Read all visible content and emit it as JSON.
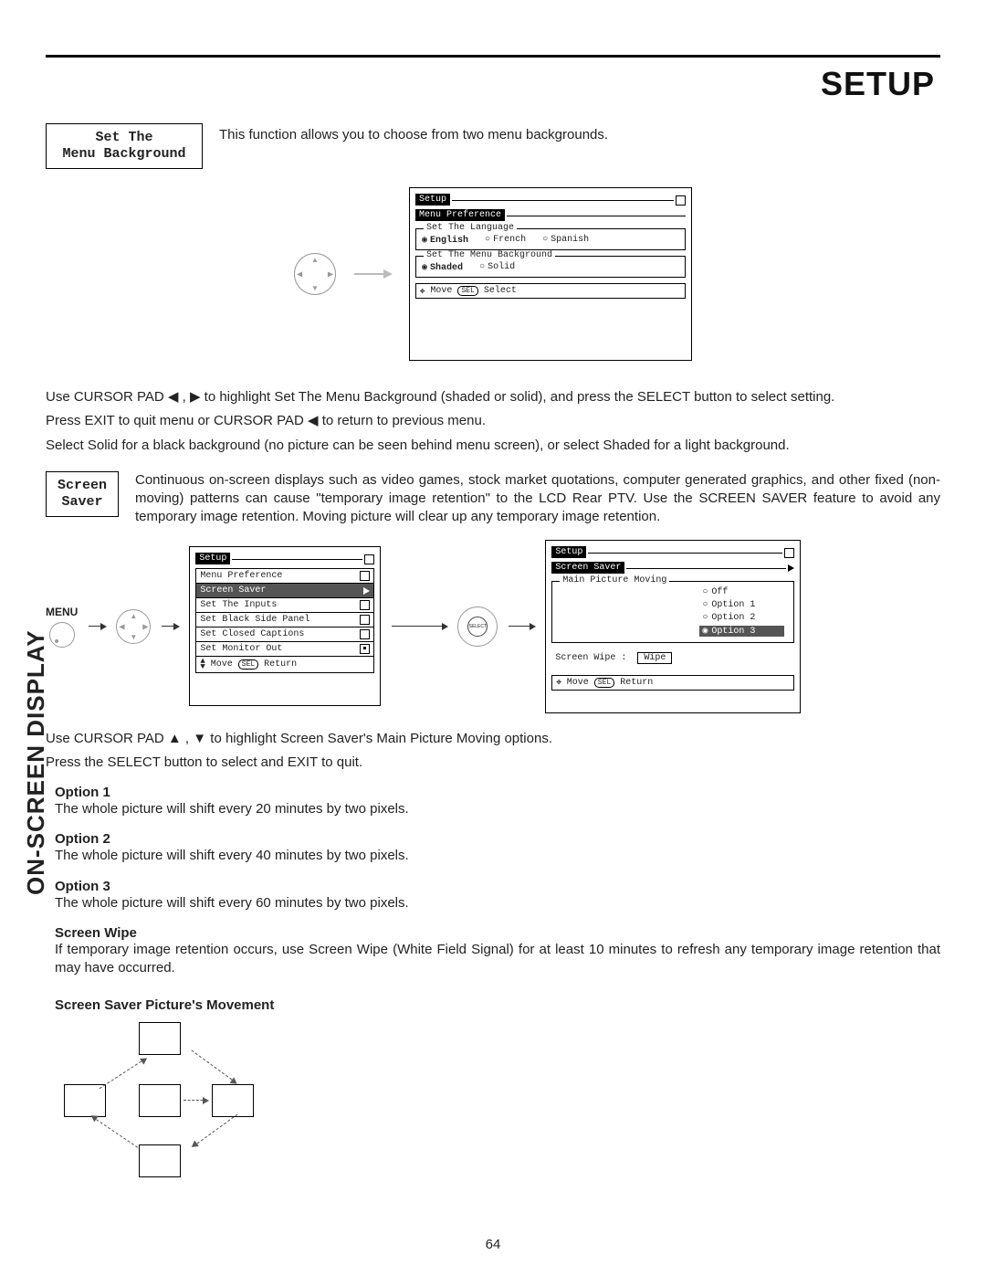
{
  "page": {
    "title": "SETUP",
    "sideLabel": "ON-SCREEN DISPLAY",
    "number": "64"
  },
  "section1": {
    "label_line1": "Set The",
    "label_line2": "Menu Background",
    "desc": "This function allows you to choose from two menu backgrounds.",
    "post1": "Use CURSOR PAD ◀ , ▶ to highlight Set The Menu Background (shaded or solid), and press the SELECT button to select setting.",
    "post2": "Press EXIT to quit menu or CURSOR PAD ◀ to return to previous menu.",
    "post3": "Select Solid for a black background (no picture can be seen behind menu screen), or select Shaded for a light background."
  },
  "tv1": {
    "setup": "Setup",
    "menuPref": "Menu Preference",
    "langLegend": "Set The Language",
    "lang": {
      "english": "English",
      "french": "French",
      "spanish": "Spanish"
    },
    "bgLegend": "Set The Menu Background",
    "bg": {
      "shaded": "Shaded",
      "solid": "Solid"
    },
    "hintMove": "Move",
    "hintSel": "SEL",
    "hintSelect": "Select"
  },
  "section2": {
    "label_line1": "Screen",
    "label_line2": "Saver",
    "desc": "Continuous on-screen displays such as video games, stock market quotations, computer generated graphics, and other fixed (non-moving) patterns can cause \"temporary image retention\" to the LCD Rear PTV.  Use the SCREEN SAVER feature to avoid any temporary image retention.  Moving picture will clear up any temporary image retention.",
    "menuLabel": "MENU",
    "post1": "Use CURSOR PAD ▲ , ▼ to highlight Screen Saver's Main Picture Moving options.",
    "post2": "Press the SELECT button to select and EXIT to quit."
  },
  "menuList": {
    "title": "Setup",
    "items": [
      "Menu Preference",
      "Screen Saver",
      "Set The Inputs",
      "Set Black Side Panel",
      "Set Closed Captions",
      "Set Monitor Out"
    ],
    "hintMove": "Move",
    "hintSel": "SEL",
    "hintReturn": "Return"
  },
  "tv2": {
    "setup": "Setup",
    "screenSaver": "Screen Saver",
    "mainMoving": "Main Picture Moving",
    "options": {
      "off": "Off",
      "o1": "Option 1",
      "o2": "Option 2",
      "o3": "Option 3"
    },
    "wipeLabel": "Screen Wipe :",
    "wipeBtn": "Wipe",
    "hintMove": "Move",
    "hintSel": "SEL",
    "hintReturn": "Return"
  },
  "options": {
    "o1_h": "Option 1",
    "o1_t": "The whole picture will shift every 20 minutes by two pixels.",
    "o2_h": "Option 2",
    "o2_t": "The whole picture will shift every 40 minutes by two pixels.",
    "o3_h": "Option 3",
    "o3_t": "The whole picture will shift every 60 minutes by two pixels.",
    "sw_h": "Screen Wipe",
    "sw_t": "If temporary image retention occurs, use Screen Wipe (White Field Signal) for at least 10 minutes to refresh any temporary image retention that may have occurred.",
    "mv_h": "Screen Saver Picture's Movement"
  },
  "selectBtn": "SELECT"
}
